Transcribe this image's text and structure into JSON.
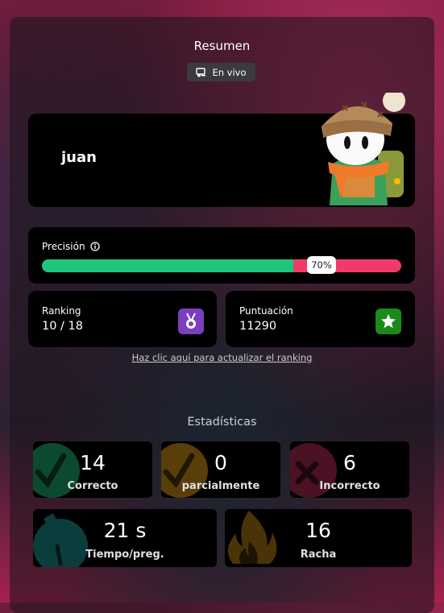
{
  "header": {
    "title": "Resumen",
    "live_label": "En vivo"
  },
  "player": {
    "name": "juan"
  },
  "precision": {
    "label": "Precisión",
    "percent": 70,
    "percent_label": "70%"
  },
  "ranking": {
    "label": "Ranking",
    "value": "10 / 18"
  },
  "score": {
    "label": "Puntuación",
    "value": "11290"
  },
  "refresh_link": "Haz clic aquí para actualizar el ranking",
  "stats": {
    "title": "Estadísticas",
    "correct": {
      "value": "14",
      "label": "Correcto"
    },
    "partial": {
      "value": "0",
      "label": "parcialmente"
    },
    "incorrect": {
      "value": "6",
      "label": "Incorrecto"
    },
    "time": {
      "value": "21 s",
      "label": "Tiempo/preg."
    },
    "streak": {
      "value": "16",
      "label": "Racha"
    }
  },
  "colors": {
    "correct": "#1dc67b",
    "incorrect": "#f03a6b",
    "ranking_badge": "#7b3fbf",
    "score_badge": "#1a8a1a"
  }
}
